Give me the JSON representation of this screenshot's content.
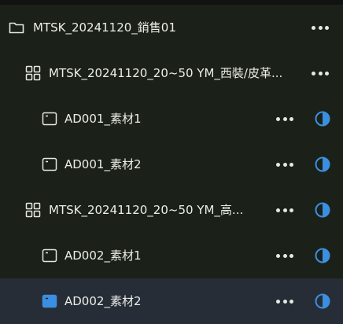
{
  "tree": {
    "rows": [
      {
        "level": 0,
        "icon": "folder-icon",
        "label": "MTSK_20241120_銷售01",
        "actions": [
          "more"
        ]
      },
      {
        "level": 1,
        "icon": "grid-icon",
        "label": "MTSK_20241120_20~50 YM_西裝/皮革...",
        "actions": [
          "more"
        ]
      },
      {
        "level": 2,
        "icon": "ad-window-icon",
        "label": "AD001_素材1",
        "actions": [
          "more",
          "status"
        ]
      },
      {
        "level": 2,
        "icon": "ad-window-icon",
        "label": "AD001_素材2",
        "actions": [
          "more",
          "status"
        ]
      },
      {
        "level": 1,
        "icon": "grid-icon",
        "label": "MTSK_20241120_20~50 YM_高...",
        "actions": [
          "more",
          "status"
        ]
      },
      {
        "level": 2,
        "icon": "ad-window-icon",
        "label": "AD002_素材1",
        "actions": [
          "more",
          "status"
        ]
      },
      {
        "level": 2,
        "icon": "ad-window-icon",
        "label": "AD002_素材2",
        "actions": [
          "more",
          "status"
        ],
        "selected": true
      }
    ]
  },
  "colors": {
    "background": "#1b2118",
    "selected_row": "#262d36",
    "accent_blue": "#3b8fe0",
    "text": "#eceee9"
  }
}
